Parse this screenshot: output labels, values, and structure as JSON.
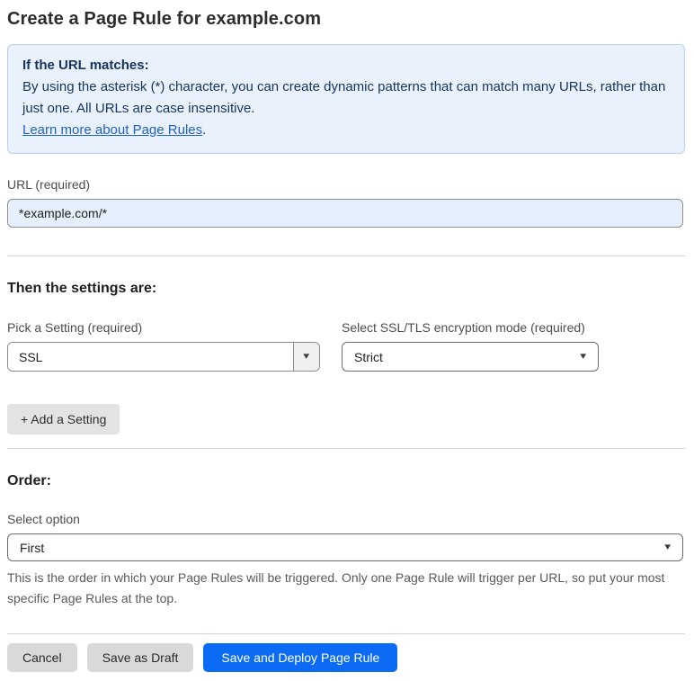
{
  "page": {
    "title": "Create a Page Rule for example.com"
  },
  "info_box": {
    "heading": "If the URL matches:",
    "body": "By using the asterisk (*) character, you can create dynamic patterns that can match many URLs, rather than just one. All URLs are case insensitive.",
    "link_label": "Learn more about Page Rules",
    "link_suffix": "."
  },
  "url_field": {
    "label": "URL (required)",
    "value": "*example.com/*"
  },
  "settings_section": {
    "heading": "Then the settings are:",
    "setting_select": {
      "label": "Pick a Setting (required)",
      "value": "SSL"
    },
    "mode_select": {
      "label": "Select SSL/TLS encryption mode (required)",
      "value": "Strict"
    },
    "add_setting_label": "+ Add a Setting"
  },
  "order_section": {
    "heading": "Order:",
    "select_label": "Select option",
    "select_value": "First",
    "help_text": "This is the order in which your Page Rules will be triggered. Only one Page Rule will trigger per URL, so put your most specific Page Rules at the top."
  },
  "footer": {
    "cancel_label": "Cancel",
    "save_draft_label": "Save as Draft",
    "save_deploy_label": "Save and Deploy Page Rule"
  },
  "icons": {
    "dropdown_arrow": "▾"
  },
  "colors": {
    "accent_blue": "#0b6cf3",
    "info_box_bg": "#e9f2fc",
    "info_box_text": "#16345c",
    "link_blue": "#2061c5",
    "url_input_bg": "#e6effc"
  }
}
